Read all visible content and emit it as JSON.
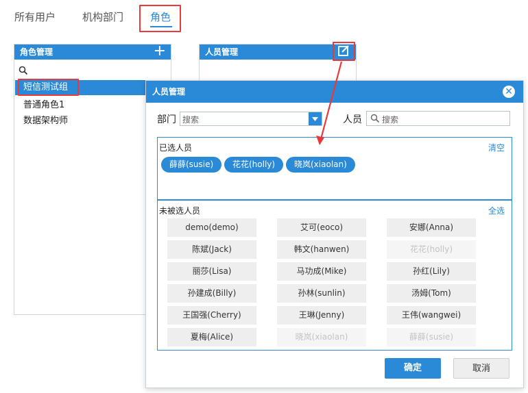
{
  "tabs": [
    {
      "label": "所有用户"
    },
    {
      "label": "机构部门"
    },
    {
      "label": "角色"
    }
  ],
  "role_panel": {
    "title": "角色管理",
    "add_icon": "plus-icon",
    "search_icon": "search-icon",
    "items": [
      {
        "label": "短信测试组",
        "selected": true
      },
      {
        "label": "普通角色1"
      },
      {
        "label": "数据架构师"
      }
    ]
  },
  "member_panel": {
    "title": "人员管理",
    "edit_icon": "edit-icon"
  },
  "modal": {
    "title": "人员管理",
    "close_icon": "close-icon",
    "dept_label": "部门",
    "dept_placeholder": "搜索",
    "person_label": "人员",
    "person_placeholder": "搜索",
    "selected_section": {
      "title": "已选人员",
      "action": "清空",
      "people": [
        "薛薛(susie)",
        "花花(holly)",
        "晓岚(xiaolan)"
      ]
    },
    "unselected_section": {
      "title": "未被选人员",
      "action": "全选",
      "people": [
        {
          "name": "demo(demo)"
        },
        {
          "name": "艾可(eoco)"
        },
        {
          "name": "安娜(Anna)"
        },
        {
          "name": "陈斌(Jack)"
        },
        {
          "name": "韩文(hanwen)"
        },
        {
          "name": "花花(holly)",
          "disabled": true
        },
        {
          "name": "丽莎(Lisa)"
        },
        {
          "name": "马功成(Mike)"
        },
        {
          "name": "孙红(Lily)"
        },
        {
          "name": "孙建成(Billy)"
        },
        {
          "name": "孙林(sunlin)"
        },
        {
          "name": "汤姆(Tom)"
        },
        {
          "name": "王国强(Cherry)"
        },
        {
          "name": "王琳(Jenny)"
        },
        {
          "name": "王伟(wangwei)"
        },
        {
          "name": "夏梅(Alice)"
        },
        {
          "name": "晓岚(xiaolan)",
          "disabled": true
        },
        {
          "name": "薛薛(susie)",
          "disabled": true
        }
      ]
    },
    "confirm_label": "确定",
    "cancel_label": "取消"
  },
  "colors": {
    "accent": "#2b8ad8",
    "annotation_red": "#e8393b"
  }
}
